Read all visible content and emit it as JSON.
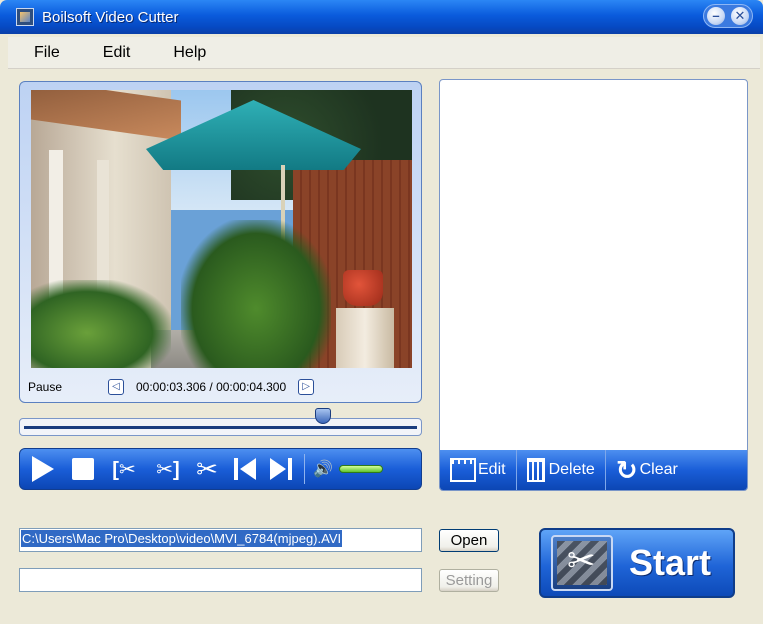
{
  "window": {
    "title": "Boilsoft Video Cutter"
  },
  "menu": {
    "items": [
      "File",
      "Edit",
      "Help"
    ]
  },
  "player": {
    "status": "Pause",
    "time_display": "00:00:03.306 / 00:00:04.300",
    "seek_position_fraction": 0.76,
    "volume_level_fraction": 0.7
  },
  "list_toolbar": {
    "edit_label": "Edit",
    "delete_label": "Delete",
    "clear_label": "Clear"
  },
  "inputs": {
    "file_path": "C:\\Users\\Mac Pro\\Desktop\\video\\MVI_6784(mjpeg).AVI",
    "output_path": ""
  },
  "buttons": {
    "open_label": "Open",
    "setting_label": "Setting",
    "start_label": "Start"
  },
  "colors": {
    "title_bar": "#0a5bdc",
    "toolbar_blue": "#1a5ed8",
    "selection": "#316ac5"
  }
}
